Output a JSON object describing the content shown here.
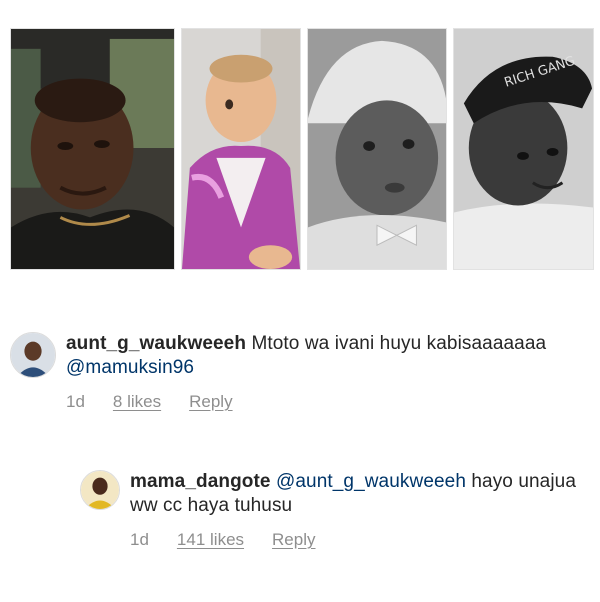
{
  "comments": [
    {
      "username": "aunt_g_waukweeeh",
      "text_before": " Mtoto wa ivani huyu kabisaaaaaaa ",
      "mention": "@mamuksin96",
      "text_after": "",
      "time": "1d",
      "likes": "8 likes",
      "reply": "Reply"
    },
    {
      "username": "mama_dangote",
      "text_before": " ",
      "mention": "@aunt_g_waukweeeh",
      "text_after": " hayo unajua ww cc haya tuhusu",
      "time": "1d",
      "likes": "141 likes",
      "reply": "Reply"
    }
  ],
  "photos": [
    {
      "desc_icon": "man-in-car-photo"
    },
    {
      "desc_icon": "toddler-pink-jacket-photo"
    },
    {
      "desc_icon": "baby-bw-photo"
    },
    {
      "desc_icon": "man-cap-bw-photo"
    }
  ]
}
